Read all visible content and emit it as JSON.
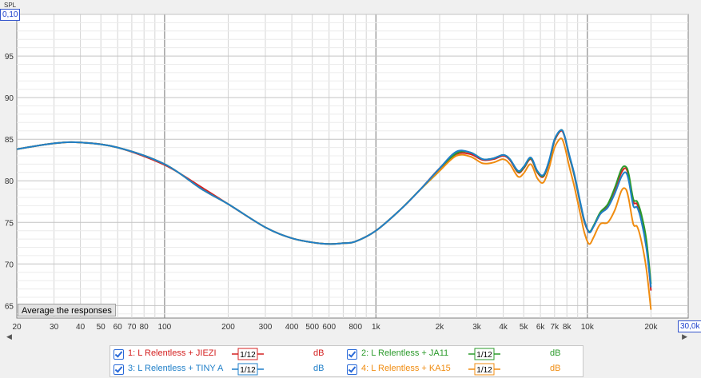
{
  "axis": {
    "y_label": "SPL",
    "y_top_value": "0,10",
    "x_max_value": "30,0k",
    "y_ticks": [
      "95",
      "90",
      "85",
      "80",
      "75",
      "70",
      "65"
    ],
    "x_ticks": [
      "20",
      "30",
      "40",
      "50",
      "60",
      "70",
      "80",
      "100",
      "200",
      "300",
      "400",
      "500",
      "600",
      "800",
      "1k",
      "2k",
      "3k",
      "4k",
      "5k",
      "6k",
      "7k",
      "8k",
      "10k",
      "20k"
    ]
  },
  "controls": {
    "average_button": "Average the responses"
  },
  "legend": [
    {
      "label": "1: L Relentless + JIEZI",
      "smoothing": "1/12",
      "unit": "dB",
      "color": "#d42020"
    },
    {
      "label": "2: L Relentless + JA11",
      "smoothing": "1/12",
      "unit": "dB",
      "color": "#2a9a2a"
    },
    {
      "label": "3: L Relentless + TINY A",
      "smoothing": "1/12",
      "unit": "dB",
      "color": "#1f7fc8"
    },
    {
      "label": "4: L Relentless + KA15",
      "smoothing": "1/12",
      "unit": "dB",
      "color": "#f08c10"
    }
  ],
  "chart_data": {
    "type": "line",
    "xscale": "log",
    "xlim": [
      20,
      30000
    ],
    "ylim": [
      63.5,
      100
    ],
    "xlabel": "",
    "ylabel": "SPL",
    "grid": true,
    "legend_position": "bottom",
    "x": [
      20,
      30,
      40,
      60,
      100,
      150,
      200,
      300,
      400,
      500,
      600,
      700,
      800,
      1000,
      1300,
      1600,
      2000,
      2400,
      2800,
      3200,
      3600,
      4000,
      4300,
      4700,
      5000,
      5400,
      5800,
      6200,
      6600,
      7000,
      7500,
      7800,
      8200,
      8700,
      9300,
      9700,
      10200,
      10700,
      11500,
      12500,
      13500,
      14500,
      15200,
      15700,
      16500,
      17200,
      18000,
      19000,
      20000
    ],
    "series": [
      {
        "name": "1: L Relentless + JIEZI",
        "color": "#d42020",
        "y": [
          83.8,
          84.5,
          84.6,
          84.0,
          81.9,
          79.2,
          77.2,
          74.4,
          73.1,
          72.6,
          72.4,
          72.5,
          72.7,
          74.0,
          76.5,
          78.8,
          81.5,
          83.2,
          83.2,
          82.5,
          82.6,
          83.0,
          82.5,
          81.0,
          81.5,
          82.6,
          81.0,
          80.5,
          82.3,
          84.8,
          86.0,
          85.3,
          83.0,
          80.5,
          77.0,
          75.0,
          73.8,
          74.5,
          76.0,
          77.0,
          79.0,
          81.0,
          81.5,
          80.5,
          77.5,
          77.2,
          75.5,
          72.5,
          66.8
        ]
      },
      {
        "name": "2: L Relentless + JA11",
        "color": "#2a9a2a",
        "y": [
          83.8,
          84.5,
          84.6,
          84.0,
          82.0,
          79.0,
          77.2,
          74.4,
          73.1,
          72.6,
          72.4,
          72.5,
          72.7,
          74.0,
          76.5,
          78.8,
          81.2,
          83.3,
          83.4,
          82.6,
          82.7,
          83.1,
          82.6,
          81.1,
          81.6,
          82.7,
          81.1,
          80.6,
          82.4,
          84.9,
          86.1,
          85.4,
          83.1,
          80.6,
          77.1,
          75.1,
          73.9,
          74.6,
          76.2,
          77.2,
          79.2,
          81.4,
          81.7,
          80.8,
          77.8,
          77.5,
          76.0,
          73.0,
          67.6
        ]
      },
      {
        "name": "3: L Relentless + TINY A",
        "color": "#1f7fc8",
        "y": [
          83.8,
          84.5,
          84.6,
          84.0,
          82.0,
          79.0,
          77.2,
          74.4,
          73.1,
          72.6,
          72.4,
          72.5,
          72.7,
          74.0,
          76.5,
          78.8,
          81.5,
          83.5,
          83.4,
          82.6,
          82.7,
          83.1,
          82.6,
          81.2,
          81.7,
          82.8,
          81.2,
          80.7,
          82.5,
          85.0,
          86.1,
          85.4,
          83.2,
          80.7,
          77.2,
          75.2,
          73.8,
          74.5,
          76.0,
          76.8,
          78.5,
          80.5,
          81.0,
          80.0,
          77.0,
          76.8,
          75.2,
          72.0,
          67.2
        ]
      },
      {
        "name": "4: L Relentless + KA15",
        "color": "#f08c10",
        "y": [
          83.8,
          84.5,
          84.6,
          84.0,
          82.0,
          79.0,
          77.2,
          74.4,
          73.1,
          72.6,
          72.4,
          72.5,
          72.7,
          74.0,
          76.5,
          78.8,
          81.2,
          83.0,
          82.9,
          82.1,
          82.2,
          82.6,
          82.0,
          80.5,
          80.9,
          82.0,
          80.3,
          79.8,
          81.6,
          84.0,
          85.1,
          84.2,
          81.8,
          79.2,
          75.8,
          73.7,
          72.4,
          73.2,
          74.8,
          75.0,
          76.5,
          78.8,
          79.0,
          77.8,
          74.8,
          74.5,
          72.8,
          69.5,
          64.5
        ]
      }
    ]
  }
}
